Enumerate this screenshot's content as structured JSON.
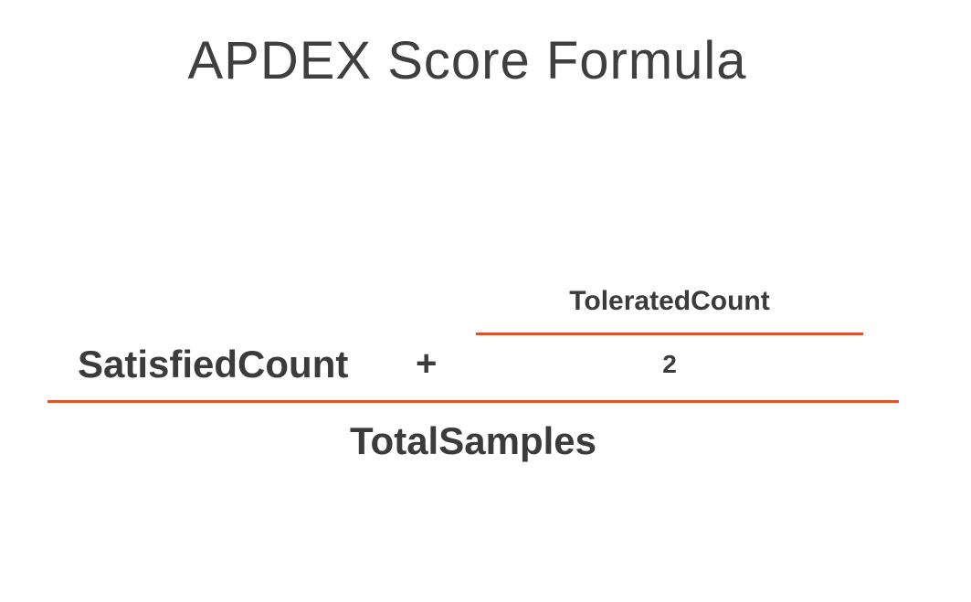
{
  "slide": {
    "title": "APDEX Score Formula"
  },
  "formula": {
    "numerator_left_term": "SatisfiedCount",
    "operator": "+",
    "inner_fraction": {
      "numerator": "ToleratedCount",
      "denominator": "2"
    },
    "denominator": "TotalSamples"
  },
  "colors": {
    "fraction_bar": "#d9532f",
    "text": "#3b3b3b",
    "background": "#ffffff"
  }
}
